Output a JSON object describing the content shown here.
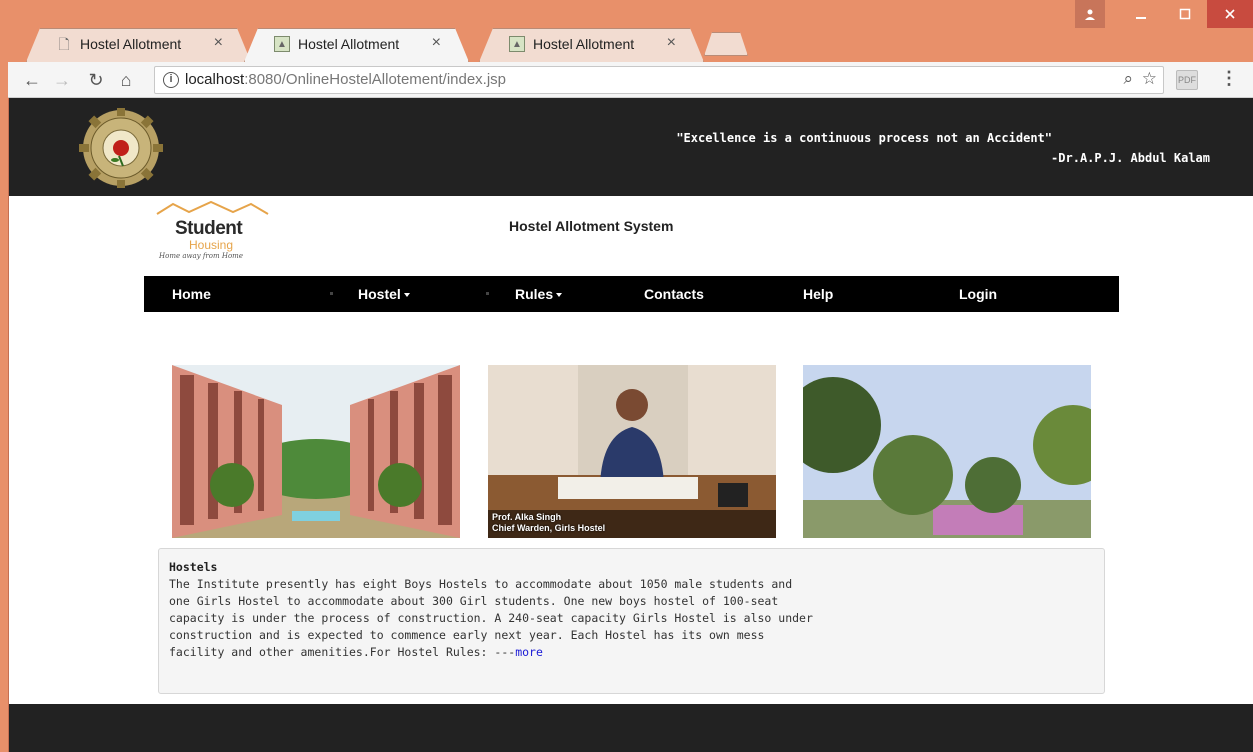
{
  "browser": {
    "tabs": [
      {
        "title": "Hostel Allotment",
        "icon": "page-icon",
        "close": "×"
      },
      {
        "title": "Hostel Allotment",
        "icon": "image-icon",
        "close": "×"
      },
      {
        "title": "Hostel Allotment",
        "icon": "image-icon",
        "close": "×"
      }
    ],
    "url_host": "localhost",
    "url_rest": ":8080/OnlineHostelAllotement/index.jsp",
    "window_buttons": {
      "user": "user-icon",
      "minimize": "minimize-icon",
      "maximize": "maximize-icon",
      "close": "close-icon"
    }
  },
  "header": {
    "quote": "\"Excellence is a continuous process not an Accident\"",
    "author": "-Dr.A.P.J. Abdul Kalam",
    "emblem": "institute-emblem"
  },
  "logo": {
    "line1": "Student",
    "line2": "Housing",
    "line3": "Home away from Home"
  },
  "site_title": "Hostel Allotment System",
  "nav": {
    "home": "Home",
    "hostel": "Hostel",
    "rules": "Rules",
    "contacts": "Contacts",
    "help": "Help",
    "login": "Login"
  },
  "photos": {
    "caption_line1": "Prof. Alka Singh",
    "caption_line2": "Chief Warden, Girls Hostel"
  },
  "info": {
    "heading": "Hostels",
    "line1": "The Institute presently has eight Boys Hostels to accommodate about 1050 male students and",
    "line2": "one Girls Hostel to accommodate about 300 Girl students. One new boys  hostel of 100-seat",
    "line3": "capacity is under the process of construction. A 240-seat capacity Girls Hostel is also under",
    "line4": "construction and is expected to commence early next year. Each Hostel has its own mess",
    "line5": "facility and other amenities.For Hostel Rules: ---",
    "more": "more"
  },
  "colors": {
    "frame": "#e8906a",
    "header_bg": "#222222",
    "nav_bg": "#000000",
    "link": "#1a1ad6"
  }
}
